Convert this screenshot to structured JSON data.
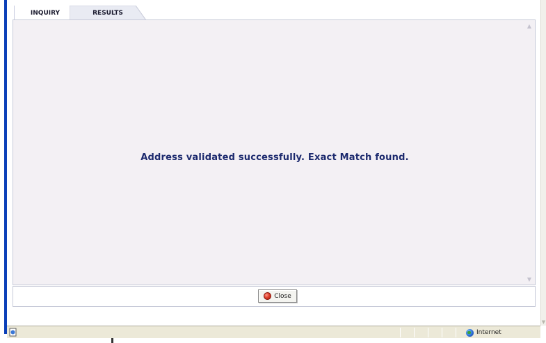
{
  "tabs": [
    {
      "label": "INQUIRY",
      "active": true
    },
    {
      "label": "RESULTS",
      "active": false
    }
  ],
  "main": {
    "message": "Address validated successfully. Exact Match found."
  },
  "footer": {
    "close_label": "Close"
  },
  "statusbar": {
    "zone_label": "Internet",
    "icons": [
      "page-icon",
      "globe-icon"
    ]
  },
  "colors": {
    "message_text": "#1c2a6e",
    "panel_background": "#f3f0f4",
    "window_border": "#0b3fb8",
    "statusbar_background": "#ece9d8"
  }
}
